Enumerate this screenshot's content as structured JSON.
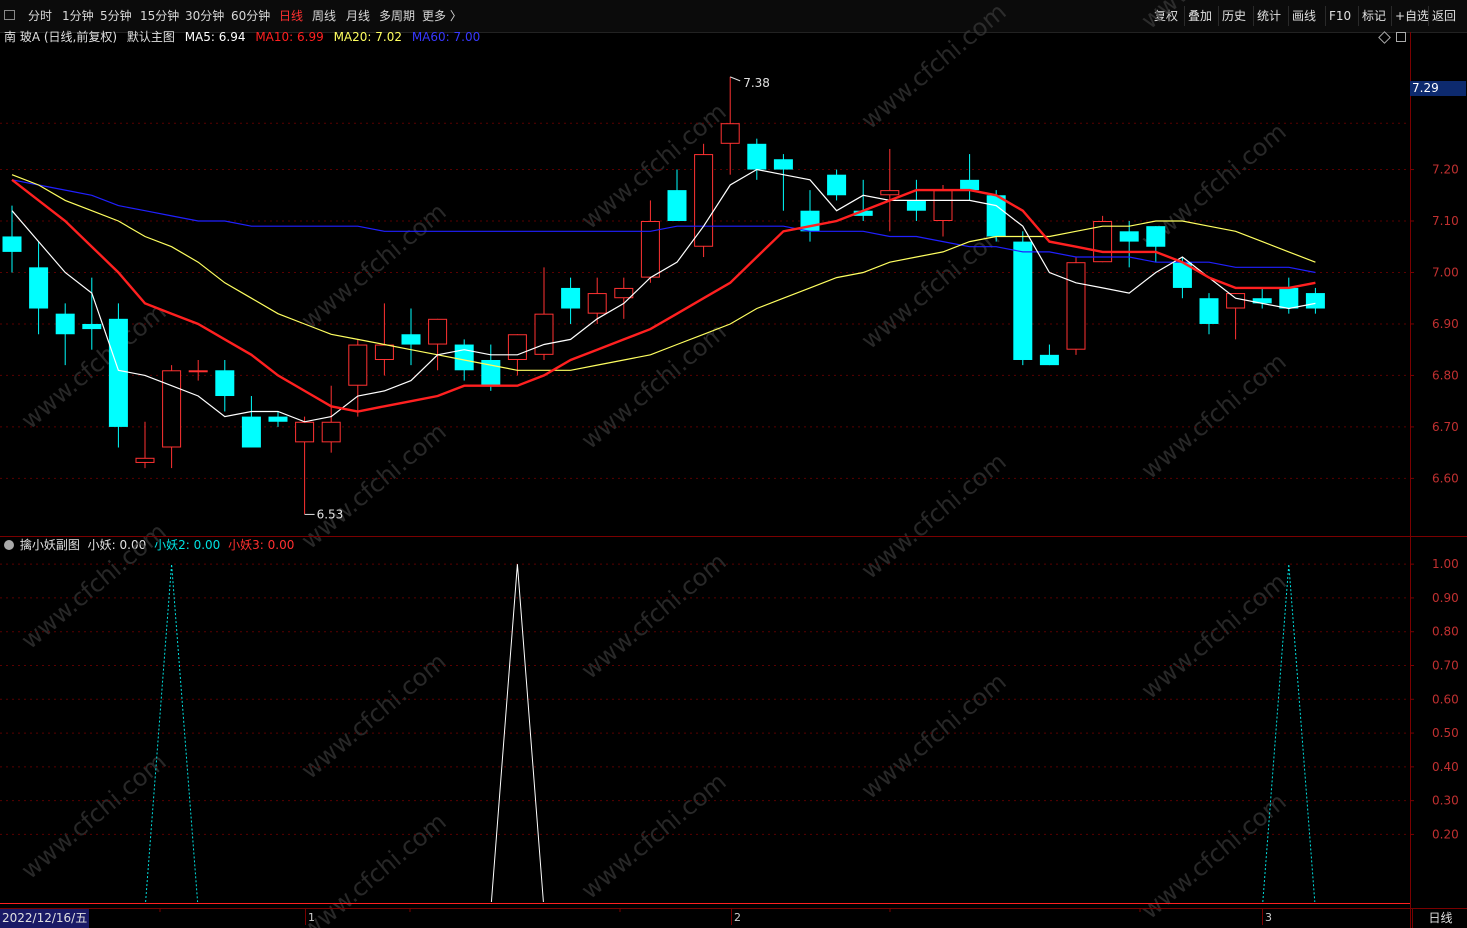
{
  "toolbar": {
    "periods": [
      "分时",
      "1分钟",
      "5分钟",
      "15分钟",
      "30分钟",
      "60分钟",
      "日线",
      "周线",
      "月线",
      "多周期",
      "更多 〉"
    ],
    "active_period": "日线",
    "right_buttons": [
      "复权",
      "叠加",
      "历史",
      "统计",
      "画线",
      "F10",
      "标记",
      "+自选",
      "返回"
    ]
  },
  "main": {
    "title": "南 玻A (日线,前复权)",
    "template": "默认主图",
    "ma5_label": "MA5: 6.94",
    "ma10_label": "MA10: 6.99",
    "ma20_label": "MA20: 7.02",
    "ma60_label": "MA60: 7.00",
    "price_tag": "7.29",
    "high_label": "7.38",
    "low_label": "6.53",
    "y_ticks": [
      "7.20",
      "7.10",
      "7.00",
      "6.90",
      "6.80",
      "6.70",
      "6.60"
    ]
  },
  "sub": {
    "title": "擒小妖副图",
    "l1": "小妖: 0.00",
    "l2": "小妖2: 0.00",
    "l3": "小妖3: 0.00",
    "y_ticks": [
      "1.00",
      "0.90",
      "0.80",
      "0.70",
      "0.60",
      "0.50",
      "0.40",
      "0.30",
      "0.20"
    ]
  },
  "bottom": {
    "date": "2022/12/16/五",
    "months": [
      "1",
      "2",
      "3"
    ],
    "tab": "日线"
  },
  "watermark": "www.cfchi.com",
  "colors": {
    "up": "#ff3232",
    "down": "#00ffff",
    "ma5": "#ffffff",
    "ma10": "#ff2020",
    "ma20": "#ffff60",
    "ma60": "#2020ff",
    "axis": "#7a0000",
    "grid": "#5a0000"
  },
  "chart_data": {
    "type": "candlestick",
    "candles": [
      {
        "o": 7.07,
        "h": 7.13,
        "l": 7.0,
        "c": 7.04
      },
      {
        "o": 7.01,
        "h": 7.06,
        "l": 6.88,
        "c": 6.93
      },
      {
        "o": 6.92,
        "h": 6.94,
        "l": 6.82,
        "c": 6.88
      },
      {
        "o": 6.9,
        "h": 6.99,
        "l": 6.85,
        "c": 6.89
      },
      {
        "o": 6.91,
        "h": 6.94,
        "l": 6.66,
        "c": 6.7
      },
      {
        "o": 6.63,
        "h": 6.71,
        "l": 6.62,
        "c": 6.64
      },
      {
        "o": 6.66,
        "h": 6.82,
        "l": 6.62,
        "c": 6.81
      },
      {
        "o": 6.81,
        "h": 6.83,
        "l": 6.79,
        "c": 6.81
      },
      {
        "o": 6.81,
        "h": 6.83,
        "l": 6.73,
        "c": 6.76
      },
      {
        "o": 6.72,
        "h": 6.76,
        "l": 6.66,
        "c": 6.66
      },
      {
        "o": 6.72,
        "h": 6.73,
        "l": 6.7,
        "c": 6.71
      },
      {
        "o": 6.67,
        "h": 6.72,
        "l": 6.53,
        "c": 6.71
      },
      {
        "o": 6.67,
        "h": 6.78,
        "l": 6.65,
        "c": 6.71
      },
      {
        "o": 6.78,
        "h": 6.87,
        "l": 6.72,
        "c": 6.86
      },
      {
        "o": 6.83,
        "h": 6.94,
        "l": 6.8,
        "c": 6.86
      },
      {
        "o": 6.88,
        "h": 6.93,
        "l": 6.82,
        "c": 6.86
      },
      {
        "o": 6.86,
        "h": 6.91,
        "l": 6.81,
        "c": 6.91
      },
      {
        "o": 6.86,
        "h": 6.87,
        "l": 6.79,
        "c": 6.81
      },
      {
        "o": 6.83,
        "h": 6.86,
        "l": 6.77,
        "c": 6.78
      },
      {
        "o": 6.83,
        "h": 6.88,
        "l": 6.8,
        "c": 6.88
      },
      {
        "o": 6.84,
        "h": 7.01,
        "l": 6.83,
        "c": 6.92
      },
      {
        "o": 6.97,
        "h": 6.99,
        "l": 6.9,
        "c": 6.93
      },
      {
        "o": 6.92,
        "h": 6.99,
        "l": 6.9,
        "c": 6.96
      },
      {
        "o": 6.95,
        "h": 6.99,
        "l": 6.91,
        "c": 6.97
      },
      {
        "o": 6.99,
        "h": 7.14,
        "l": 6.98,
        "c": 7.1
      },
      {
        "o": 7.16,
        "h": 7.2,
        "l": 7.1,
        "c": 7.1
      },
      {
        "o": 7.05,
        "h": 7.25,
        "l": 7.03,
        "c": 7.23
      },
      {
        "o": 7.25,
        "h": 7.38,
        "l": 7.19,
        "c": 7.29
      },
      {
        "o": 7.25,
        "h": 7.26,
        "l": 7.18,
        "c": 7.2
      },
      {
        "o": 7.22,
        "h": 7.23,
        "l": 7.12,
        "c": 7.2
      },
      {
        "o": 7.12,
        "h": 7.16,
        "l": 7.06,
        "c": 7.08
      },
      {
        "o": 7.19,
        "h": 7.2,
        "l": 7.14,
        "c": 7.15
      },
      {
        "o": 7.12,
        "h": 7.18,
        "l": 7.1,
        "c": 7.11
      },
      {
        "o": 7.15,
        "h": 7.24,
        "l": 7.08,
        "c": 7.16
      },
      {
        "o": 7.14,
        "h": 7.18,
        "l": 7.1,
        "c": 7.12
      },
      {
        "o": 7.1,
        "h": 7.17,
        "l": 7.07,
        "c": 7.16
      },
      {
        "o": 7.18,
        "h": 7.23,
        "l": 7.14,
        "c": 7.16
      },
      {
        "o": 7.15,
        "h": 7.16,
        "l": 7.06,
        "c": 7.07
      },
      {
        "o": 7.06,
        "h": 7.08,
        "l": 6.82,
        "c": 6.83
      },
      {
        "o": 6.84,
        "h": 6.86,
        "l": 6.82,
        "c": 6.82
      },
      {
        "o": 6.85,
        "h": 7.03,
        "l": 6.84,
        "c": 7.02
      },
      {
        "o": 7.02,
        "h": 7.11,
        "l": 7.02,
        "c": 7.1
      },
      {
        "o": 7.08,
        "h": 7.1,
        "l": 7.01,
        "c": 7.06
      },
      {
        "o": 7.09,
        "h": 7.09,
        "l": 7.02,
        "c": 7.05
      },
      {
        "o": 7.02,
        "h": 7.03,
        "l": 6.95,
        "c": 6.97
      },
      {
        "o": 6.95,
        "h": 6.96,
        "l": 6.88,
        "c": 6.9
      },
      {
        "o": 6.93,
        "h": 6.96,
        "l": 6.87,
        "c": 6.96
      },
      {
        "o": 6.95,
        "h": 6.97,
        "l": 6.93,
        "c": 6.94
      },
      {
        "o": 6.97,
        "h": 6.99,
        "l": 6.92,
        "c": 6.93
      },
      {
        "o": 6.96,
        "h": 6.97,
        "l": 6.92,
        "c": 6.93
      }
    ],
    "ma5": [
      7.12,
      7.06,
      7.0,
      6.96,
      6.81,
      6.8,
      6.78,
      6.76,
      6.72,
      6.73,
      6.73,
      6.71,
      6.72,
      6.76,
      6.77,
      6.79,
      6.84,
      6.85,
      6.84,
      6.84,
      6.86,
      6.87,
      6.91,
      6.94,
      6.99,
      7.02,
      7.09,
      7.17,
      7.2,
      7.19,
      7.18,
      7.12,
      7.15,
      7.14,
      7.14,
      7.14,
      7.14,
      7.13,
      7.09,
      7.0,
      6.98,
      6.97,
      6.96,
      7.0,
      7.03,
      6.99,
      6.95,
      6.94,
      6.93,
      6.94
    ],
    "ma10": [
      7.18,
      7.14,
      7.1,
      7.05,
      7.0,
      6.94,
      6.92,
      6.9,
      6.87,
      6.84,
      6.8,
      6.77,
      6.74,
      6.73,
      6.74,
      6.75,
      6.76,
      6.78,
      6.78,
      6.78,
      6.8,
      6.83,
      6.85,
      6.87,
      6.89,
      6.92,
      6.95,
      6.98,
      7.03,
      7.08,
      7.09,
      7.1,
      7.12,
      7.14,
      7.16,
      7.16,
      7.16,
      7.15,
      7.12,
      7.06,
      7.05,
      7.04,
      7.04,
      7.04,
      7.02,
      6.99,
      6.97,
      6.97,
      6.97,
      6.98
    ],
    "ma20": [
      7.19,
      7.17,
      7.14,
      7.12,
      7.1,
      7.07,
      7.05,
      7.02,
      6.98,
      6.95,
      6.92,
      6.9,
      6.88,
      6.87,
      6.86,
      6.85,
      6.84,
      6.83,
      6.82,
      6.81,
      6.81,
      6.81,
      6.82,
      6.83,
      6.84,
      6.86,
      6.88,
      6.9,
      6.93,
      6.95,
      6.97,
      6.99,
      7.0,
      7.02,
      7.03,
      7.04,
      7.06,
      7.07,
      7.07,
      7.07,
      7.08,
      7.09,
      7.09,
      7.1,
      7.1,
      7.09,
      7.08,
      7.06,
      7.04,
      7.02
    ],
    "ma60": [
      7.18,
      7.17,
      7.16,
      7.15,
      7.13,
      7.12,
      7.11,
      7.1,
      7.1,
      7.09,
      7.09,
      7.09,
      7.09,
      7.09,
      7.08,
      7.08,
      7.08,
      7.08,
      7.08,
      7.08,
      7.08,
      7.08,
      7.08,
      7.08,
      7.08,
      7.09,
      7.09,
      7.09,
      7.09,
      7.09,
      7.08,
      7.08,
      7.08,
      7.07,
      7.07,
      7.06,
      7.05,
      7.05,
      7.04,
      7.04,
      7.03,
      7.03,
      7.03,
      7.02,
      7.02,
      7.02,
      7.01,
      7.01,
      7.01,
      7.0
    ],
    "price_range": [
      6.49,
      7.44
    ],
    "sub_range": [
      0,
      1.03
    ],
    "sub_series": [
      {
        "name": "小妖2",
        "peak_index": 6,
        "value": 1.0
      },
      {
        "name": "小妖",
        "peak_index": 19,
        "value": 1.0
      },
      {
        "name": "小妖2",
        "peak_index": 48,
        "value": 1.0
      }
    ]
  }
}
